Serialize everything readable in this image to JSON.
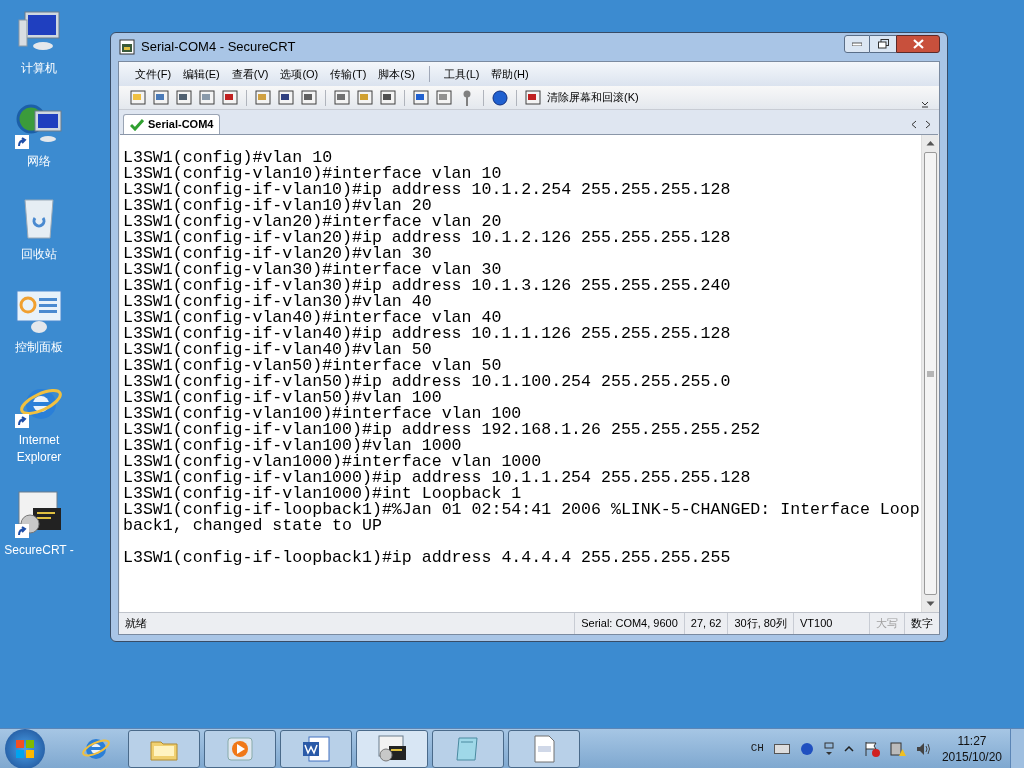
{
  "desktop_icons": [
    {
      "label": "计算机",
      "kind": "computer",
      "shortcut": false
    },
    {
      "label": "网络",
      "kind": "network",
      "shortcut": true
    },
    {
      "label": "回收站",
      "kind": "bin",
      "shortcut": false
    },
    {
      "label": "控制面板",
      "kind": "panel",
      "shortcut": false
    },
    {
      "label": "Internet Explorer",
      "kind": "ie",
      "shortcut": true
    },
    {
      "label": "SecureCRT -",
      "kind": "crt",
      "shortcut": true
    }
  ],
  "window": {
    "title": "Serial-COM4 - SecureCRT"
  },
  "menu": [
    "文件(F)",
    "编辑(E)",
    "查看(V)",
    "选项(O)",
    "传输(T)",
    "脚本(S)",
    "工具(L)",
    "帮助(H)"
  ],
  "toolbar": {
    "clear_button": "清除屏幕和回滚(K)"
  },
  "tabs": [
    {
      "label": "Serial-COM4",
      "selected": true,
      "connected": true
    }
  ],
  "terminal": {
    "lines": [
      {
        "text": "L3SW1(config)#vlan 10",
        "blank_before": false
      },
      {
        "text": "L3SW1(config-vlan10)#interface vlan 10",
        "blank_before": false
      },
      {
        "text": "L3SW1(config-if-vlan10)#ip address 10.1.2.254 255.255.255.128",
        "blank_before": false
      },
      {
        "text": "L3SW1(config-if-vlan10)#vlan 20",
        "blank_before": false
      },
      {
        "text": "L3SW1(config-vlan20)#interface vlan 20",
        "blank_before": false
      },
      {
        "text": "L3SW1(config-if-vlan20)#ip address 10.1.2.126 255.255.255.128",
        "blank_before": false
      },
      {
        "text": "L3SW1(config-if-vlan20)#vlan 30",
        "blank_before": false
      },
      {
        "text": "L3SW1(config-vlan30)#interface vlan 30",
        "blank_before": false
      },
      {
        "text": "L3SW1(config-if-vlan30)#ip address 10.1.3.126 255.255.255.240",
        "blank_before": false
      },
      {
        "text": "L3SW1(config-if-vlan30)#vlan 40",
        "blank_before": false
      },
      {
        "text": "L3SW1(config-vlan40)#interface vlan 40",
        "blank_before": false
      },
      {
        "text": "L3SW1(config-if-vlan40)#ip address 10.1.1.126 255.255.255.128",
        "blank_before": false
      },
      {
        "text": "L3SW1(config-if-vlan40)#vlan 50",
        "blank_before": false
      },
      {
        "text": "L3SW1(config-vlan50)#interface vlan 50",
        "blank_before": false
      },
      {
        "text": "L3SW1(config-if-vlan50)#ip address 10.1.100.254 255.255.255.0",
        "blank_before": false
      },
      {
        "text": "L3SW1(config-if-vlan50)#vlan 100",
        "blank_before": false
      },
      {
        "text": "L3SW1(config-vlan100)#interface vlan 100",
        "blank_before": false
      },
      {
        "text": "L3SW1(config-if-vlan100)#ip address 192.168.1.26 255.255.255.252",
        "blank_before": false
      },
      {
        "text": "L3SW1(config-if-vlan100)#vlan 1000",
        "blank_before": false
      },
      {
        "text": "L3SW1(config-vlan1000)#interface vlan 1000",
        "blank_before": false
      },
      {
        "text": "L3SW1(config-if-vlan1000)#ip address 10.1.1.254 255.255.255.128",
        "blank_before": false
      },
      {
        "text": "L3SW1(config-if-vlan1000)#int Loopback 1",
        "blank_before": false
      },
      {
        "text": "L3SW1(config-if-loopback1)#%Jan 01 02:54:41 2006 %LINK-5-CHANGED: Interface Loop",
        "blank_before": false
      },
      {
        "text": "back1, changed state to UP",
        "blank_before": false
      },
      {
        "text": "L3SW1(config-if-loopback1)#ip address 4.4.4.4 255.255.255.255",
        "blank_before": true
      }
    ]
  },
  "status_bar": [
    {
      "text": "就绪",
      "disabled": false
    },
    {
      "text": "Serial: COM4, 9600",
      "disabled": false
    },
    {
      "text": "27,  62",
      "disabled": false
    },
    {
      "text": "30行, 80列",
      "disabled": false
    },
    {
      "text": "VT100",
      "disabled": false
    },
    {
      "text": "大写",
      "disabled": true
    },
    {
      "text": "数字",
      "disabled": false
    }
  ],
  "taskbar": {
    "apps": [
      {
        "kind": "ie",
        "selected": false
      },
      {
        "kind": "folder",
        "selected": false
      },
      {
        "kind": "media",
        "selected": false
      },
      {
        "kind": "word",
        "selected": false
      },
      {
        "kind": "crt",
        "selected": true
      },
      {
        "kind": "notepad",
        "selected": false
      },
      {
        "kind": "doc",
        "selected": false
      }
    ],
    "language": "CH",
    "time": "11:27",
    "date": "2015/10/20"
  }
}
